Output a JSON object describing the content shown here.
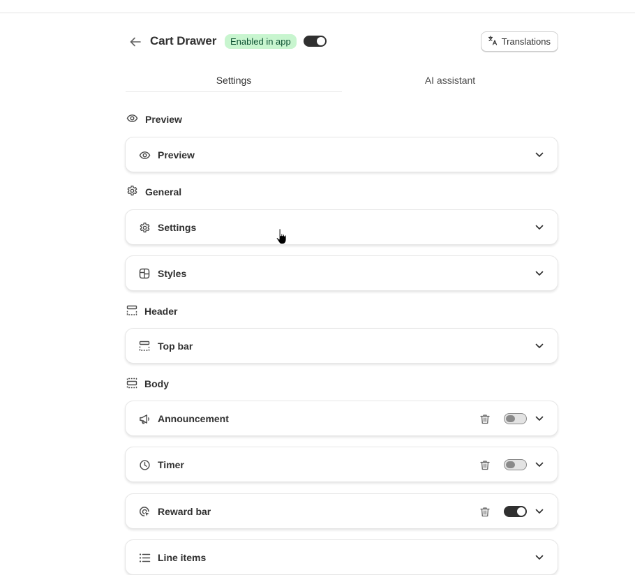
{
  "header": {
    "title": "Cart Drawer",
    "status_badge": "Enabled in app",
    "enabled": true,
    "translations_label": "Translations",
    "badge_color": "#c8f5cf"
  },
  "tabs": [
    {
      "label": "Settings",
      "active": true
    },
    {
      "label": "AI assistant",
      "active": false
    }
  ],
  "sections": {
    "preview": {
      "title": "Preview",
      "icon": "eye-icon"
    },
    "general": {
      "title": "General",
      "icon": "gear-icon"
    },
    "header": {
      "title": "Header",
      "icon": "layout-header-icon"
    },
    "body": {
      "title": "Body",
      "icon": "layout-body-icon"
    }
  },
  "cards": {
    "preview": {
      "label": "Preview",
      "icon": "eye-icon"
    },
    "settings": {
      "label": "Settings",
      "icon": "gear-icon"
    },
    "styles": {
      "label": "Styles",
      "icon": "styles-icon"
    },
    "top_bar": {
      "label": "Top bar",
      "icon": "layout-header-icon"
    },
    "announcement": {
      "label": "Announcement",
      "icon": "megaphone-icon",
      "enabled": false
    },
    "timer": {
      "label": "Timer",
      "icon": "clock-icon",
      "enabled": false
    },
    "reward_bar": {
      "label": "Reward bar",
      "icon": "target-icon",
      "enabled": true
    },
    "line_items": {
      "label": "Line items",
      "icon": "list-icon"
    }
  }
}
